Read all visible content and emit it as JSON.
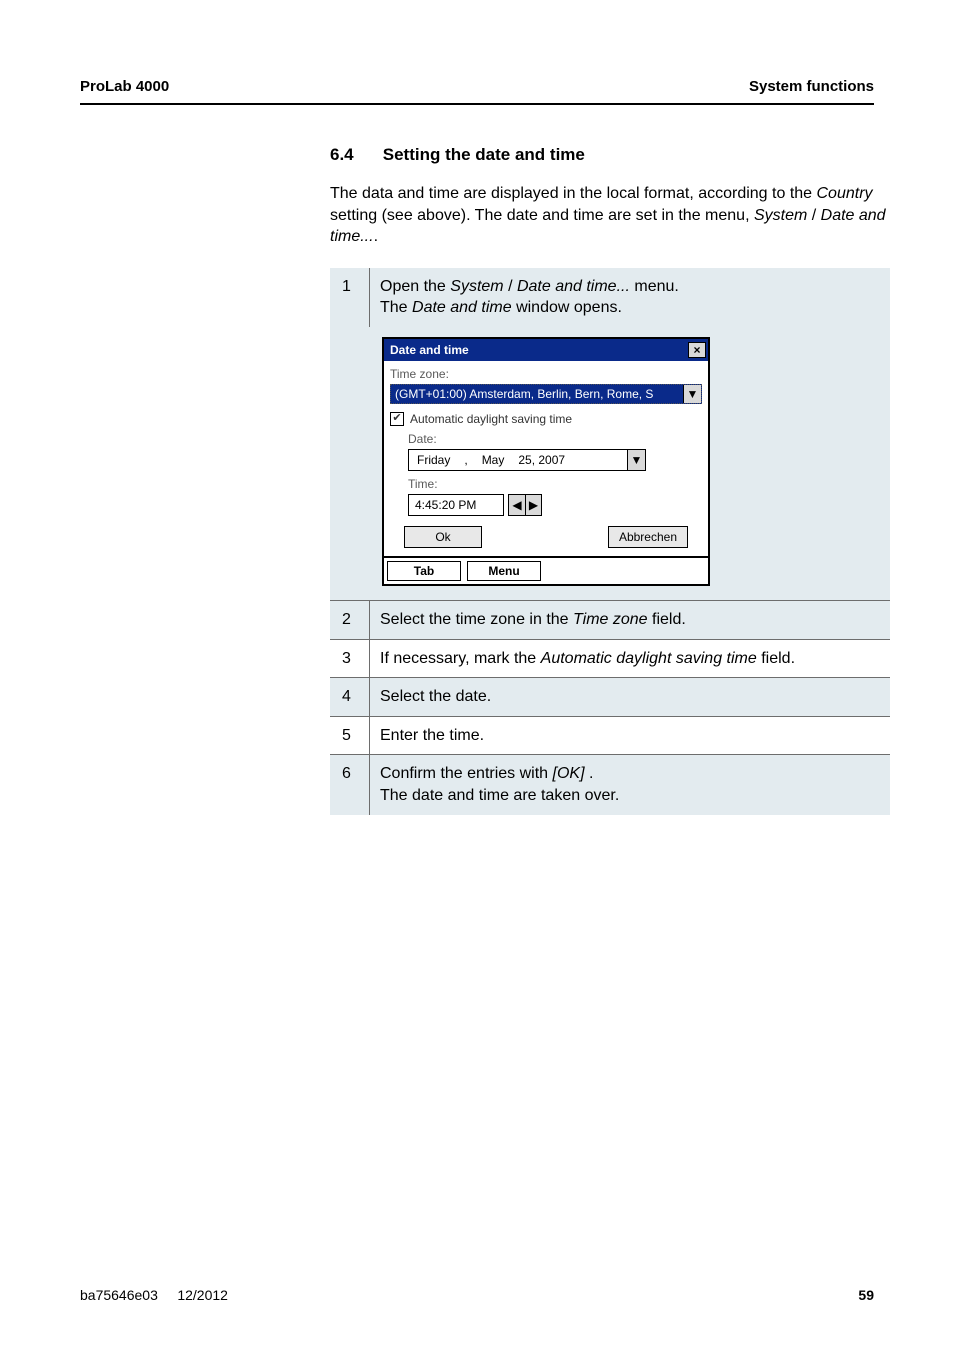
{
  "header": {
    "left": "ProLab 4000",
    "right": "System functions"
  },
  "section": {
    "number": "6.4",
    "title": "Setting the date and time",
    "intro_a": "The data and time are displayed in the local format, according to the ",
    "intro_b": "Country",
    "intro_c": " setting (see above). The date and time are set in the menu, ",
    "intro_d": "System",
    "intro_e": " / ",
    "intro_f": "Date and time...",
    "intro_g": "."
  },
  "steps": {
    "s1": {
      "num": "1",
      "a": "Open the ",
      "b": "System",
      "c": " / ",
      "d": "Date and time...",
      "e": " menu.",
      "f": "The ",
      "g": "Date and time",
      "h": " window opens."
    },
    "s2": {
      "num": "2",
      "a": "Select the time zone in the ",
      "b": "Time zone",
      "c": " field."
    },
    "s3": {
      "num": "3",
      "a": "If necessary, mark the ",
      "b": "Automatic daylight saving time",
      "c": " field."
    },
    "s4": {
      "num": "4",
      "a": "Select the date."
    },
    "s5": {
      "num": "5",
      "a": "Enter the time."
    },
    "s6": {
      "num": "6",
      "a": "Confirm the entries with ",
      "b": "[OK]",
      "c": " .",
      "d": "The date and time are taken over."
    }
  },
  "dialog": {
    "title": "Date and time",
    "close": "×",
    "tz_label": "Time zone:",
    "tz_value": "(GMT+01:00) Amsterdam, Berlin, Bern, Rome, S",
    "dst": "Automatic daylight saving time",
    "date_label": "Date:",
    "date_day": "Friday",
    "date_sep": ",",
    "date_month": "May",
    "date_rest": "25, 2007",
    "time_label": "Time:",
    "time_value": "4:45:20 PM",
    "ok": "Ok",
    "cancel": "Abbrechen",
    "tab": "Tab",
    "menu": "Menu",
    "arrow_down": "▼",
    "arrow_left": "◀",
    "arrow_right": "▶",
    "check": "✔"
  },
  "footer": {
    "left_a": "ba75646e03",
    "left_b": "12/2012",
    "right": "59"
  }
}
